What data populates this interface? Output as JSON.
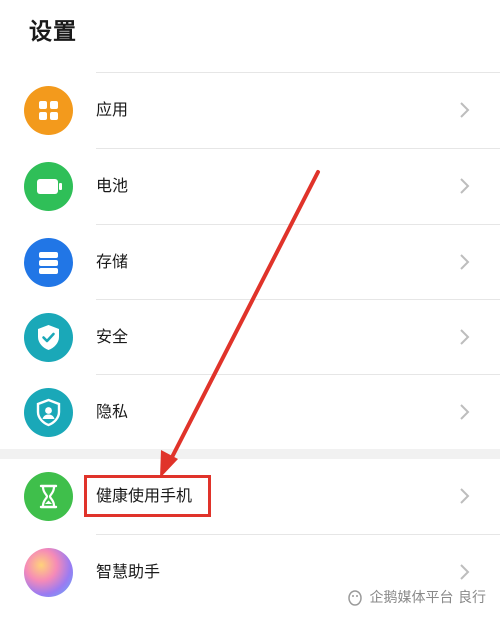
{
  "page": {
    "title": "设置"
  },
  "settings": {
    "items": [
      {
        "label": "应用",
        "icon": "grid-icon",
        "color": "#f39a1c"
      },
      {
        "label": "电池",
        "icon": "battery-icon",
        "color": "#2fbf58"
      },
      {
        "label": "存储",
        "icon": "storage-icon",
        "color": "#2176e6"
      },
      {
        "label": "安全",
        "icon": "shield-check-icon",
        "color": "#1aa8b8"
      },
      {
        "label": "隐私",
        "icon": "privacy-shield-icon",
        "color": "#1aa8b8"
      },
      {
        "label": "健康使用手机",
        "icon": "hourglass-icon",
        "color": "#3fbf4b"
      },
      {
        "label": "智慧助手",
        "icon": "assistant-orb-icon",
        "color": "#c07ee0"
      }
    ]
  },
  "annotation": {
    "highlight_color": "#e0332a"
  },
  "watermark": {
    "text": "企鹅媒体平台 良行"
  }
}
